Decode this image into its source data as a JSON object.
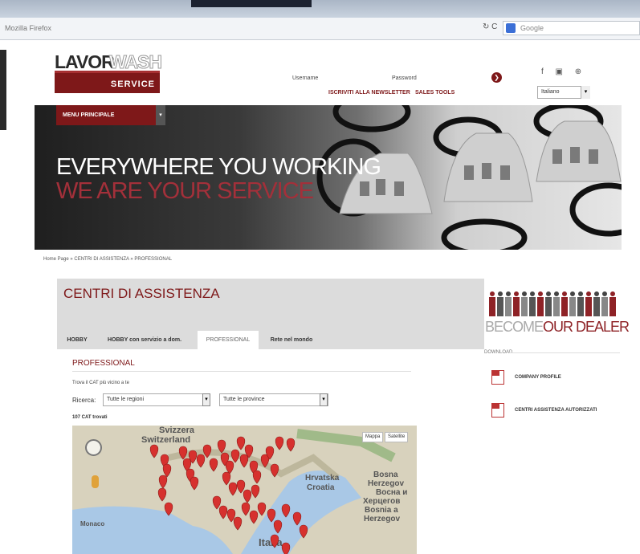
{
  "browser": {
    "address": "Mozilla Firefox",
    "search_placeholder": "Google",
    "refresh": "↻ C"
  },
  "logo": {
    "lavor": "LAVOR",
    "wash": "WASH",
    "service": "SERVICE"
  },
  "login": {
    "username_label": "Username",
    "password_label": "Password",
    "go": "❯"
  },
  "header_links": {
    "newsletter": "ISCRIVITI ALLA NEWSLETTER",
    "sales": "SALES TOOLS"
  },
  "social": "f  ▣  ⊕",
  "language": "Italiano",
  "menu": {
    "label": "MENU PRINCIPALE"
  },
  "banner": {
    "line1": "EVERYWHERE YOU WORKING",
    "line2": "WE ARE YOUR SERVICE"
  },
  "breadcrumb": "Home Page » CENTRI DI ASSISTENZA » PROFESSIONAL",
  "content": {
    "title": "CENTRI DI ASSISTENZA",
    "tabs": [
      "HOBBY",
      "HOBBY con servizio a dom.",
      "PROFESSIONAL",
      "Rete nel mondo"
    ],
    "section": "PROFESSIONAL",
    "hint": "Trova il CAT più vicino a te",
    "ricerca": "Ricerca:",
    "select_region": "Tutte le regioni",
    "select_province": "Tutte le province",
    "found": "107 CAT trovati",
    "map_type": [
      "Mappa",
      "Satellite"
    ],
    "map_places": [
      "Svizzera",
      "Switzerland",
      "Hrvatska",
      "Croatia",
      "Bosna",
      "Herzegov",
      "Bocнa и",
      "Xерцегов",
      "Bosnia a",
      "Herzegov",
      "Monaco",
      "Italia"
    ]
  },
  "sidebar": {
    "dealer_1": "BECOME ",
    "dealer_2": "OUR DEALER",
    "download_title": "DOWNLOAD",
    "downloads": [
      "COMPANY PROFILE",
      "CENTRI ASSISTENZA AUTORIZZATI"
    ]
  },
  "colors": {
    "brand": "#7e1819",
    "accent": "#a3303a"
  }
}
